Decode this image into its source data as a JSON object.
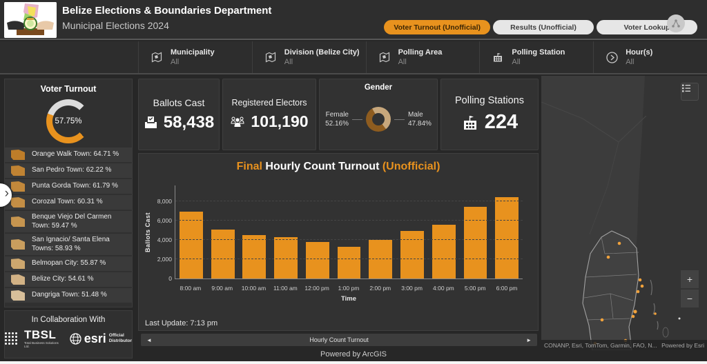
{
  "theme": {
    "accent": "#e8921e",
    "gauge_rest": "#dcdcdc"
  },
  "header": {
    "title": "Belize Elections & Boundaries Department",
    "subtitle": "Municipal Elections 2024",
    "tabs": [
      {
        "label": "Voter Turnout (Unofficial)",
        "active": true
      },
      {
        "label": "Results (Unofficial)",
        "active": false
      },
      {
        "label": "Voter Lookup",
        "active": false
      }
    ]
  },
  "filters": [
    {
      "label": "Municipality",
      "value": "All"
    },
    {
      "label": "Division (Belize City)",
      "value": "All"
    },
    {
      "label": "Polling Area",
      "value": "All"
    },
    {
      "label": "Polling Station",
      "value": "All"
    },
    {
      "label": "Hour(s)",
      "value": "All"
    }
  ],
  "sidebar": {
    "title": "Voter Turnout",
    "gauge": {
      "value": "57.75%",
      "percent": 57.75
    },
    "turnout_list": [
      {
        "label": "Orange Walk Town: 64.71 %",
        "color": "#be7d29"
      },
      {
        "label": "San Pedro Town: 62.22 %",
        "color": "#c08333"
      },
      {
        "label": "Punta Gorda Town: 61.79 %",
        "color": "#c2883b"
      },
      {
        "label": "Corozal Town: 60.31 %",
        "color": "#c48e45"
      },
      {
        "label": "Benque Viejo Del Carmen Town: 59.47 %",
        "color": "#c6954f"
      },
      {
        "label": "San Ignacio/ Santa Elena Towns: 58.93 %",
        "color": "#c99e5e"
      },
      {
        "label": "Belmopan City: 55.87 %",
        "color": "#cda76e"
      },
      {
        "label": "Belize City: 54.61 %",
        "color": "#d2b285"
      },
      {
        "label": "Dangriga Town: 51.48 %",
        "color": "#d8bf9a"
      }
    ],
    "collab": {
      "title": "In Collaboration With",
      "tbsl": "TBSL",
      "tbsl_sub": "Total Business Solutions Ltd.",
      "esri": "esri",
      "esri_sub_1": "Official",
      "esri_sub_2": "Distributor"
    }
  },
  "kpis": {
    "ballots": {
      "label": "Ballots Cast",
      "value": "58,438"
    },
    "electors": {
      "label": "Registered Electors",
      "value": "101,190"
    },
    "gender": {
      "title": "Gender",
      "female_label": "Female",
      "female_value": "52.16%",
      "female_pct": 52.16,
      "female_color": "#8e5c1f",
      "male_label": "Male",
      "male_value": "47.84%",
      "male_pct": 47.84,
      "male_color": "#c7a77c"
    },
    "stations": {
      "label": "Polling Stations",
      "value": "224"
    }
  },
  "chart_data": {
    "type": "bar",
    "title_parts": {
      "p1": "Final",
      "p2": " Hourly Count Turnout ",
      "p3": "(Unofficial)"
    },
    "categories": [
      "8:00 am",
      "9:00 am",
      "10:00 am",
      "11:00 am",
      "12:00 pm",
      "1:00 pm",
      "2:00 pm",
      "3:00 pm",
      "4:00 pm",
      "5:00 pm",
      "6:00 pm"
    ],
    "values": [
      6900,
      5050,
      4500,
      4250,
      3750,
      3250,
      4000,
      4900,
      5550,
      7400,
      8400
    ],
    "xlabel": "Time",
    "ylabel": "Ballots Cast",
    "yticks": [
      0,
      2000,
      4000,
      6000,
      8000
    ],
    "ylim": [
      0,
      9600
    ],
    "grid": true,
    "legend": false,
    "bar_color": "#e8921e"
  },
  "chart_footer": {
    "last_update": "Last Update: 7:13 pm",
    "pager_label": "Hourly Count Turnout"
  },
  "map": {
    "attribution": "CONANP, Esri, TomTom, Garmin, FAO, N...",
    "powered": "Powered by Esri",
    "zoom_in": "+",
    "zoom_out": "−"
  },
  "footer": {
    "powered": "Powered by ArcGIS"
  }
}
